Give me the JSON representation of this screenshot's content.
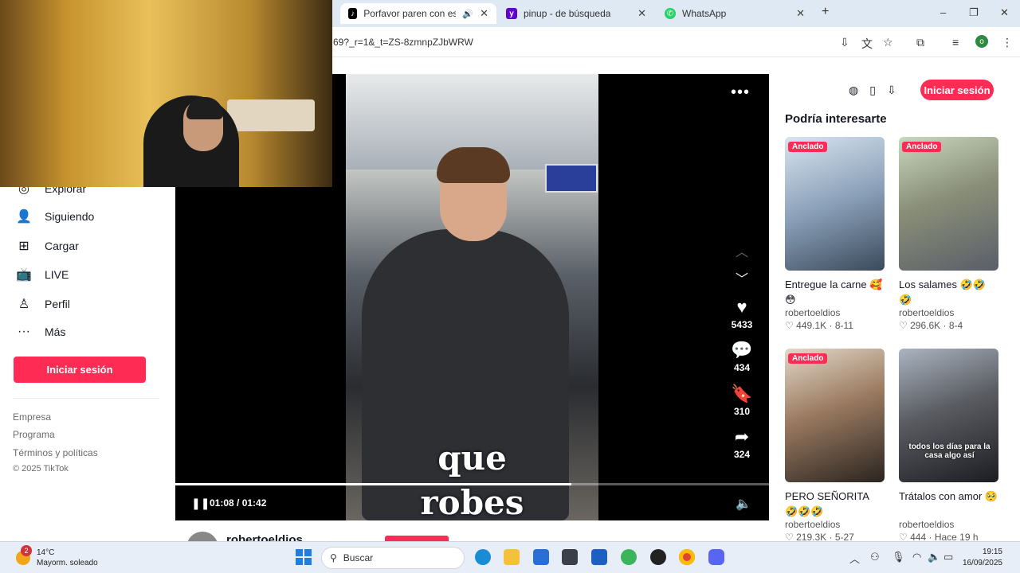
{
  "browser": {
    "tabs": [
      {
        "title": "Porfavor paren con esto 😄",
        "active": true
      },
      {
        "title": "pinup - de búsqueda",
        "active": false
      },
      {
        "title": "WhatsApp",
        "active": false
      }
    ],
    "new_tab": "+",
    "url": "69?_r=1&_t=ZS-8zmnpZJbWRW",
    "window_controls": [
      "–",
      "❐",
      "✕"
    ]
  },
  "sidebar": {
    "items": [
      {
        "label": "Explorar",
        "icon": "compass-icon"
      },
      {
        "label": "Siguiendo",
        "icon": "following-icon"
      },
      {
        "label": "Cargar",
        "icon": "upload-icon"
      },
      {
        "label": "LIVE",
        "icon": "live-icon"
      },
      {
        "label": "Perfil",
        "icon": "profile-icon"
      },
      {
        "label": "Más",
        "icon": "more-icon"
      }
    ],
    "login": "Iniciar sesión",
    "footer": [
      "Empresa",
      "Programa",
      "Términos y políticas"
    ],
    "copyright": "© 2025 TikTok"
  },
  "video": {
    "caption_line1": "que",
    "caption_line2": "robes",
    "likes": "5433",
    "comments": "434",
    "saves": "310",
    "shares": "324",
    "time": "01:08 / 01:42",
    "progress": 0.667,
    "author": "robertoeldios"
  },
  "rail": {
    "login": "Iniciar sesión",
    "title": "Podría interesarte",
    "cards": [
      {
        "pinned": "Anclado",
        "title": "Entregue la carne 🥰😳",
        "author": "robertoeldios",
        "likes": "449.1K",
        "date": "8-11",
        "thumb_text": ""
      },
      {
        "pinned": "Anclado",
        "title": "Los salames 🤣🤣🤣",
        "author": "robertoeldios",
        "likes": "296.6K",
        "date": "8-4",
        "thumb_text": ""
      },
      {
        "pinned": "Anclado",
        "title": "PERO SEÑORITA 🤣🤣🤣",
        "author": "robertoeldios",
        "likes": "219.3K",
        "date": "5-27",
        "thumb_text": ""
      },
      {
        "pinned": "",
        "title": "Trátalos con amor 🥺",
        "author": "robertoeldios",
        "likes": "444",
        "date": "Hace 19 h",
        "thumb_text": "todos los días para la casa algo así"
      }
    ]
  },
  "taskbar": {
    "weather_temp": "14°C",
    "weather_desc": "Mayorm. soleado",
    "weather_badge": "2",
    "search": "Buscar",
    "time": "19:15",
    "date": "16/09/2025"
  },
  "colors": {
    "accent": "#fe2c55",
    "taskbar": "#e8eef7"
  }
}
